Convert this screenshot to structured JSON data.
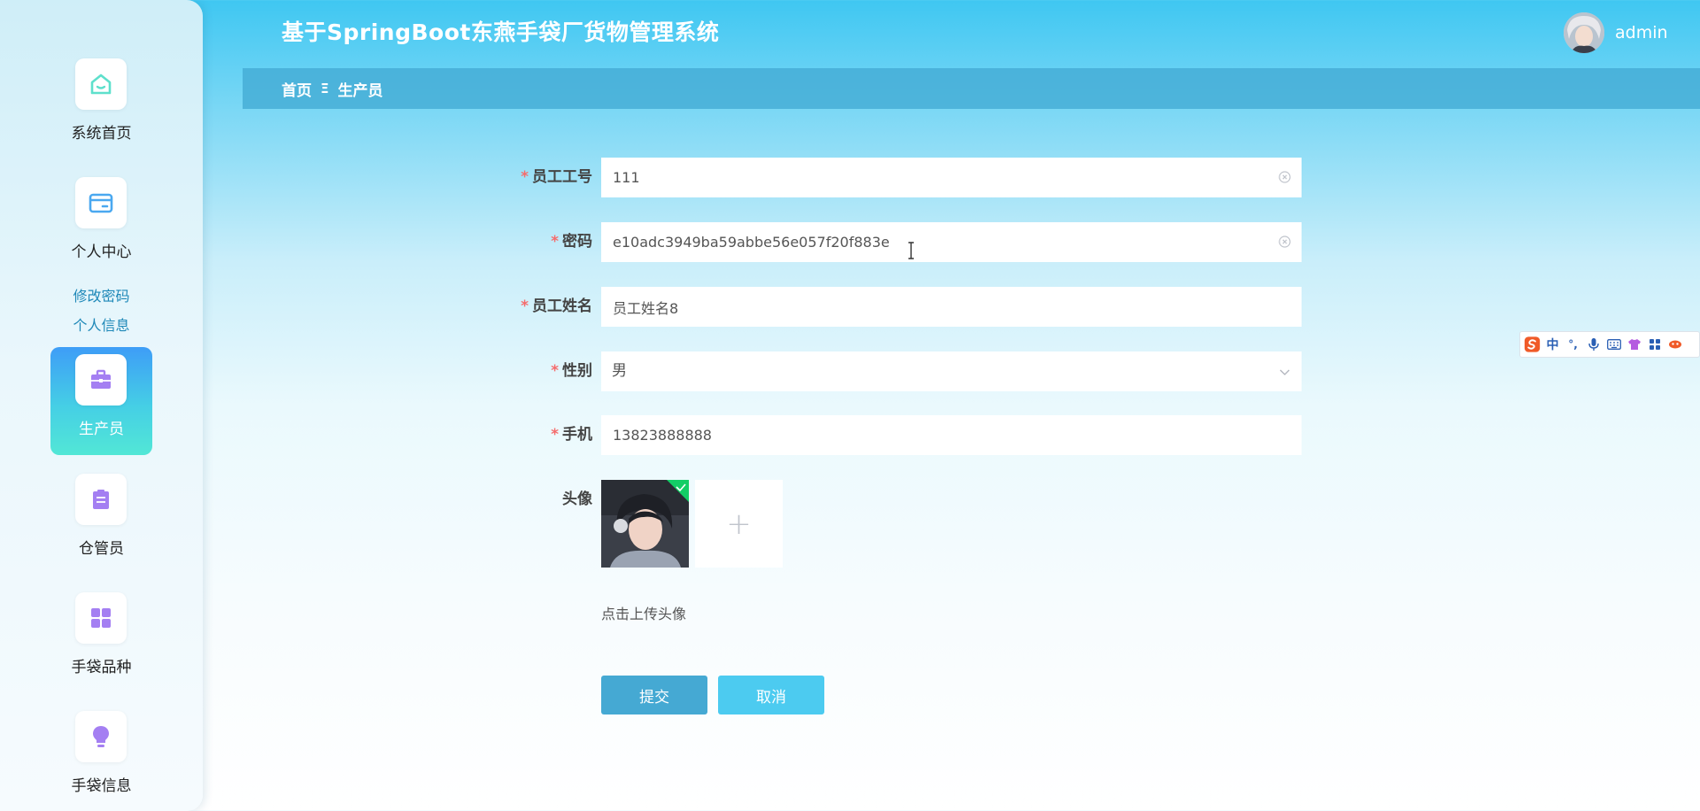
{
  "app": {
    "title": "基于SpringBoot东燕手袋厂货物管理系统"
  },
  "user": {
    "name": "admin"
  },
  "sidebar": {
    "items": [
      {
        "label": "系统首页",
        "icon": "home-icon"
      },
      {
        "label": "个人中心",
        "icon": "wallet-card-icon"
      },
      {
        "label": "生产员",
        "icon": "briefcase-icon",
        "active": true
      },
      {
        "label": "仓管员",
        "icon": "clipboard-icon"
      },
      {
        "label": "手袋品种",
        "icon": "grid-icon"
      },
      {
        "label": "手袋信息",
        "icon": "lightbulb-icon"
      }
    ],
    "submenu": [
      {
        "label": "修改密码"
      },
      {
        "label": "个人信息"
      }
    ]
  },
  "breadcrumb": {
    "home": "首页",
    "separator": "Ξ",
    "current": "生产员"
  },
  "form": {
    "required_mark": "*",
    "employee_no": {
      "label": "员工工号",
      "value": "111"
    },
    "password": {
      "label": "密码",
      "value": "e10adc3949ba59abbe56e057f20f883e"
    },
    "employee_name": {
      "label": "员工姓名",
      "value": "员工姓名8"
    },
    "gender": {
      "label": "性别",
      "value": "男"
    },
    "phone": {
      "label": "手机",
      "value": "13823888888"
    },
    "avatar": {
      "label": "头像",
      "hint": "点击上传头像",
      "upload_symbol": "+"
    },
    "submit_label": "提交",
    "cancel_label": "取消"
  },
  "ime": {
    "items": [
      "中",
      "°,"
    ]
  },
  "colors": {
    "accent": "#45a9d3",
    "cancel": "#4ccbf0",
    "required": "#f56c6c",
    "sidebar_active_top": "#3e9df7",
    "sidebar_active_bottom": "#52e7d6"
  }
}
